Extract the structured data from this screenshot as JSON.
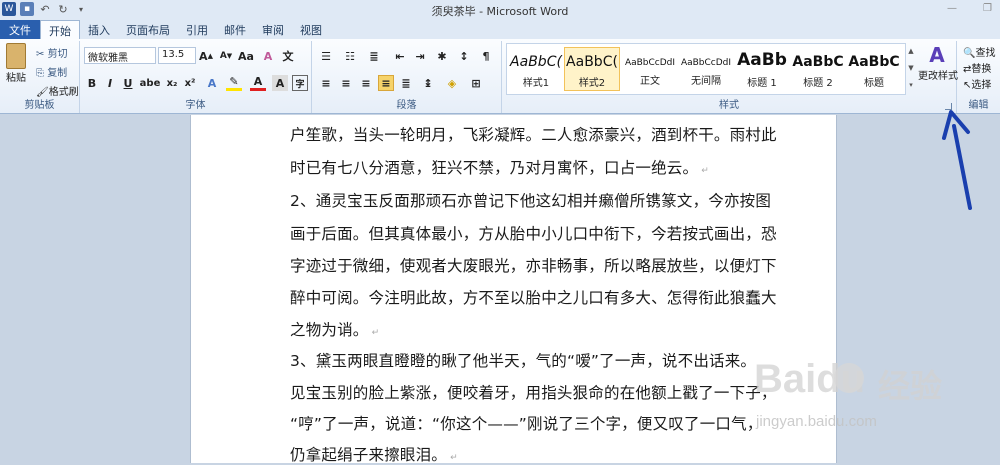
{
  "window": {
    "title": "须臾茶毕 - Microsoft Word"
  },
  "tabs": [
    "文件",
    "开始",
    "插入",
    "页面布局",
    "引用",
    "邮件",
    "审阅",
    "视图"
  ],
  "clipboard": {
    "paste": "粘贴",
    "cut": "剪切",
    "copy": "复制",
    "painter": "格式刷",
    "label": "剪贴板"
  },
  "font": {
    "name": "微软雅黑",
    "size": "13.5",
    "label": "字体"
  },
  "paragraph": {
    "label": "段落"
  },
  "styles": {
    "label": "样式",
    "items": [
      {
        "preview": "AaBbC(",
        "name": "样式1"
      },
      {
        "preview": "AaBbC(",
        "name": "样式2"
      },
      {
        "preview": "AaBbCcDdI",
        "name": "正文"
      },
      {
        "preview": "AaBbCcDdI",
        "name": "无间隔"
      },
      {
        "preview": "AaBb",
        "name": "标题 1"
      },
      {
        "preview": "AaBbC",
        "name": "标题 2"
      },
      {
        "preview": "AaBbC",
        "name": "标题"
      }
    ],
    "change": "更改样式"
  },
  "editing": {
    "label": "编辑",
    "find": "查找",
    "replace": "替换",
    "select": "选择"
  },
  "document": {
    "lines": [
      "户笙歌，当头一轮明月，飞彩凝辉。二人愈添豪兴，酒到杯干。雨村此",
      "时已有七八分酒意，狂兴不禁，乃对月寓怀，口占一绝云。",
      "2、通灵宝玉反面那顽石亦曾记下他这幻相并癞僧所镌篆文，今亦按图",
      "画于后面。但其真体最小，方从胎中小儿口中衔下，今若按式画出，恐",
      "字迹过于微细，使观者大废眼光，亦非畅事，所以略展放些，以便灯下",
      "醉中可阅。今注明此故，方不至以胎中之儿口有多大、怎得衔此狼蠢大",
      "之物为诮。",
      "3、黛玉两眼直瞪瞪的瞅了他半天，气的“嗳”了一声，说不出话来。",
      "见宝玉别的脸上紫涨，便咬着牙，用指头狠命的在他额上戳了一下子，",
      "“哼”了一声，说道：“你这个——”刚说了三个字，便又叹了一口气，",
      "仍拿起绢子来擦眼泪。"
    ]
  },
  "watermark": {
    "brand": "Baidu",
    "cn": "经验",
    "url": "jingyan.baidu.com"
  },
  "colors": {
    "arrow": "#1a3fae",
    "file_tab": "#2a5fae"
  }
}
